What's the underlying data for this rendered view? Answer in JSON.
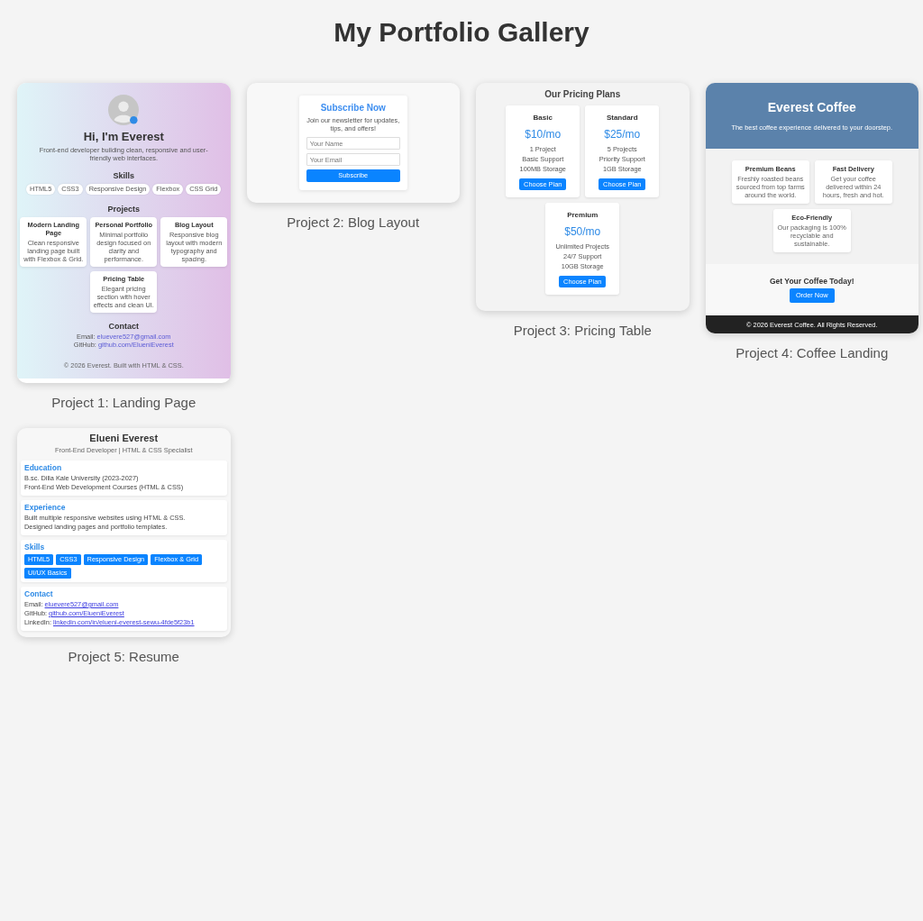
{
  "page": {
    "title": "My Portfolio Gallery"
  },
  "projects": [
    {
      "kind": "landing",
      "caption": "Project 1: Landing Page",
      "preview": {
        "heading": "Hi, I'm Everest",
        "intro": "Front-end developer building clean, responsive and user-friendly web interfaces.",
        "skills_title": "Skills",
        "skills": [
          "HTML5",
          "CSS3",
          "Responsive Design",
          "Flexbox",
          "CSS Grid"
        ],
        "projects_title": "Projects",
        "projects": [
          {
            "title": "Modern Landing Page",
            "description": "Clean responsive landing page built with Flexbox & Grid."
          },
          {
            "title": "Personal Portfolio",
            "description": "Minimal portfolio design focused on clarity and performance."
          },
          {
            "title": "Blog Layout",
            "description": "Responsive blog layout with modern typography and spacing."
          },
          {
            "title": "Pricing Table",
            "description": "Elegant pricing section with hover effects and clean UI."
          }
        ],
        "contact_title": "Contact",
        "contact": [
          {
            "label": "Email:",
            "link": "eluevere527@gmail.com"
          },
          {
            "label": "GitHub:",
            "link": "github.com/ElueniEverest"
          }
        ],
        "footer": "© 2026 Everest. Built with HTML & CSS."
      }
    },
    {
      "kind": "subscribe",
      "caption": "Project 2: Blog Layout",
      "preview": {
        "title": "Subscribe Now",
        "text": "Join our newsletter for updates, tips, and offers!",
        "fields": [
          {
            "placeholder": "Your Name"
          },
          {
            "placeholder": "Your Email"
          }
        ],
        "button": "Subscribe"
      }
    },
    {
      "kind": "pricing",
      "caption": "Project 3: Pricing Table",
      "preview": {
        "title": "Our Pricing Plans",
        "plans": [
          {
            "name": "Basic",
            "price": "$10/mo",
            "features": [
              "1 Project",
              "Basic Support",
              "100MB Storage"
            ],
            "button": "Choose Plan"
          },
          {
            "name": "Standard",
            "price": "$25/mo",
            "features": [
              "5 Projects",
              "Priority Support",
              "1GB Storage"
            ],
            "button": "Choose Plan"
          },
          {
            "name": "Premium",
            "price": "$50/mo",
            "features": [
              "Unlimited Projects",
              "24/7 Support",
              "10GB Storage"
            ],
            "button": "Choose Plan"
          }
        ]
      }
    },
    {
      "kind": "coffee",
      "caption": "Project 4: Coffee Landing",
      "preview": {
        "title": "Everest Coffee",
        "tagline": "The best coffee experience delivered to your doorstep.",
        "features": [
          {
            "title": "Premium Beans",
            "description": "Freshly roasted beans sourced from top farms around the world."
          },
          {
            "title": "Fast Delivery",
            "description": "Get your coffee delivered within 24 hours, fresh and hot."
          },
          {
            "title": "Eco-Friendly",
            "description": "Our packaging is 100% recyclable and sustainable."
          }
        ],
        "cta_title": "Get Your Coffee Today!",
        "cta_button": "Order Now",
        "footer": "© 2026 Everest Coffee. All Rights Reserved."
      }
    },
    {
      "kind": "resume",
      "caption": "Project 5: Resume",
      "preview": {
        "name": "Elueni Everest",
        "subtitle": "Front-End Developer | HTML & CSS Specialist",
        "sections": [
          {
            "kind": "list",
            "title": "Education",
            "items": [
              "B.sc. Dilla Kale University (2023-2027)",
              "Front-End Web Development Courses (HTML & CSS)"
            ]
          },
          {
            "kind": "list",
            "title": "Experience",
            "items": [
              "Built multiple responsive websites using HTML & CSS.",
              "Designed landing pages and portfolio templates."
            ]
          },
          {
            "kind": "tags",
            "title": "Skills",
            "items": [
              "HTML5",
              "CSS3",
              "Responsive Design",
              "Flexbox & Grid",
              "UI/UX Basics"
            ]
          },
          {
            "kind": "links",
            "title": "Contact",
            "items": [
              {
                "label": "Email:",
                "link": "eluevere527@gmail.com"
              },
              {
                "label": "GitHub:",
                "link": "github.com/ElueniEverest"
              },
              {
                "label": "LinkedIn:",
                "link": "linkedin.com/in/elueni-everest-sewu-4fde5f23b1"
              }
            ]
          }
        ]
      }
    }
  ]
}
